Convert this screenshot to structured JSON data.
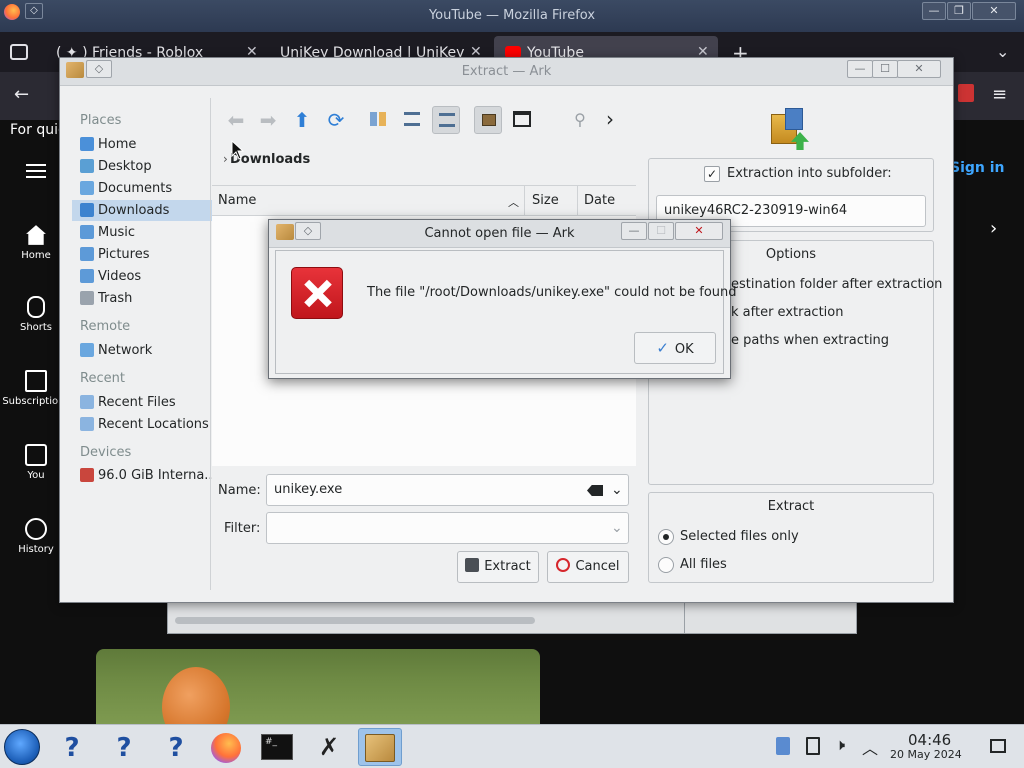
{
  "firefox": {
    "window_title": "YouTube — Mozilla Firefox",
    "tabs": [
      {
        "label": "( ✦ ) Friends - Roblox"
      },
      {
        "label": "UniKey Download | UniKey"
      },
      {
        "label": "YouTube"
      }
    ],
    "new_tab_symbol": "+",
    "banner_text": "For quic"
  },
  "youtube": {
    "sign_in": "Sign in",
    "sidebar": [
      {
        "label": "Home"
      },
      {
        "label": "Shorts"
      },
      {
        "label": "Subscriptions"
      },
      {
        "label": "You"
      },
      {
        "label": "History"
      }
    ]
  },
  "ark": {
    "window_title": "Extract — Ark",
    "places": {
      "places_heading": "Places",
      "places_items": [
        "Home",
        "Desktop",
        "Documents",
        "Downloads",
        "Music",
        "Pictures",
        "Videos",
        "Trash"
      ],
      "selected": "Downloads",
      "remote_heading": "Remote",
      "remote_items": [
        "Network"
      ],
      "recent_heading": "Recent",
      "recent_items": [
        "Recent Files",
        "Recent Locations"
      ],
      "devices_heading": "Devices",
      "devices_items": [
        "96.0 GiB Interna..."
      ]
    },
    "breadcrumb": "Downloads",
    "columns": {
      "name": "Name",
      "size": "Size",
      "date": "Date"
    },
    "name_label": "Name:",
    "name_value": "unikey.exe",
    "filter_label": "Filter:",
    "filter_value": "",
    "extract_button": "Extract",
    "cancel_button": "Cancel",
    "subfolder_label": "Extraction into subfolder:",
    "subfolder_checked": true,
    "subfolder_value": "unikey46RC2-230919-win64",
    "options_title": "Options",
    "options_items": [
      "estination folder after extraction",
      "k after extraction",
      "e paths when extracting"
    ],
    "extract_group_title": "Extract",
    "extract_options": [
      {
        "label": "Selected files only",
        "selected": true
      },
      {
        "label": "All files",
        "selected": false
      }
    ]
  },
  "error_dialog": {
    "title": "Cannot open file — Ark",
    "message": "The file \"/root/Downloads/unikey.exe\" could not be found",
    "ok_button": "OK"
  },
  "taskbar": {
    "time": "04:46",
    "date": "20 May 2024",
    "terminal_label": "#_"
  }
}
